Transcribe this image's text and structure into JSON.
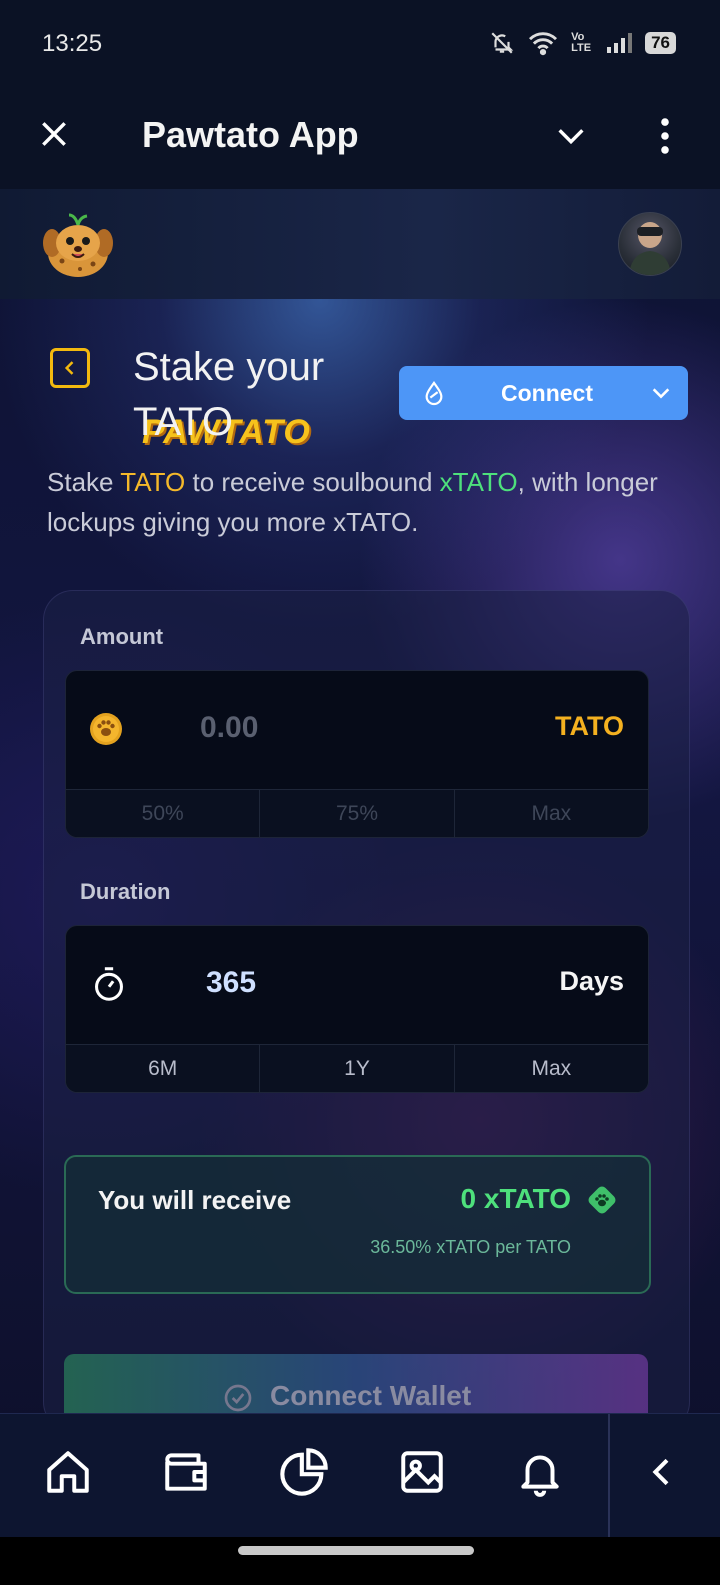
{
  "status_bar": {
    "time": "13:25",
    "battery": "76",
    "network": "Vo LTE"
  },
  "app_bar": {
    "title": "Pawtato App"
  },
  "site_header": {
    "brand": "PAWTATO"
  },
  "page": {
    "title": "Stake your TATO",
    "connect_label": "Connect",
    "desc": {
      "p1": "Stake ",
      "token": "TATO",
      "p2": " to receive soulbound ",
      "xtoken": "xTATO",
      "p3": ", with longer lockups giving you more xTATO."
    }
  },
  "amount": {
    "label": "Amount",
    "placeholder": "0.00",
    "token": "TATO",
    "chips": [
      "50%",
      "75%",
      "Max"
    ]
  },
  "duration": {
    "label": "Duration",
    "value": "365",
    "unit": "Days",
    "chips": [
      "6M",
      "1Y",
      "Max"
    ]
  },
  "receive": {
    "label": "You will receive",
    "value": "0 xTATO",
    "rate": "36.50% xTATO per TATO"
  },
  "connect_wallet": {
    "label": "Connect Wallet"
  },
  "bottom_nav": [
    "home-icon",
    "wallet-icon",
    "chart-pie-icon",
    "image-icon",
    "bell-icon",
    "chevron-left-icon"
  ],
  "colors": {
    "accent_yellow": "#f5b92a",
    "accent_green": "#4ee07c",
    "connect_blue": "#4d96f7"
  }
}
